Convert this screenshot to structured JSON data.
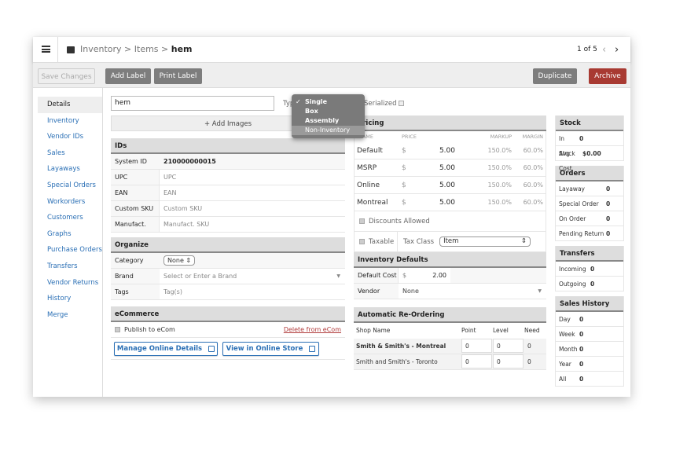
{
  "header": {
    "breadcrumb": [
      "Inventory",
      "Items",
      "hem"
    ],
    "pager": "1 of 5"
  },
  "toolbar": {
    "save": "Save Changes",
    "add_label": "Add Label",
    "print_label": "Print Label",
    "duplicate": "Duplicate",
    "archive": "Archive"
  },
  "colors": {
    "archive": "#a83a32",
    "link": "#2a6fb5",
    "delete_link": "#b03a3a"
  },
  "sidebar": [
    "Details",
    "Inventory",
    "Vendor IDs",
    "Sales",
    "Layaways",
    "Special Orders",
    "Workorders",
    "Customers",
    "Graphs",
    "Purchase Orders",
    "Transfers",
    "Vendor Returns",
    "History",
    "Merge"
  ],
  "item": {
    "name": "hem",
    "add_images": "+ Add Images",
    "type_label": "Type",
    "serialized": "Serialized"
  },
  "type_dropdown": {
    "options": [
      "Single",
      "Box",
      "Assembly",
      "Non-Inventory"
    ],
    "selected": "Single",
    "highlighted": "Non-Inventory"
  },
  "ids": {
    "title": "IDs",
    "system_id_label": "System ID",
    "system_id": "210000000015",
    "rows": [
      {
        "label": "UPC",
        "placeholder": "UPC"
      },
      {
        "label": "EAN",
        "placeholder": "EAN"
      },
      {
        "label": "Custom SKU",
        "placeholder": "Custom SKU"
      },
      {
        "label": "Manufact. SKU",
        "placeholder": "Manufact. SKU"
      }
    ]
  },
  "organize": {
    "title": "Organize",
    "category_label": "Category",
    "category": "None",
    "brand_label": "Brand",
    "brand_placeholder": "Select or Enter a Brand",
    "tags_label": "Tags",
    "tags_placeholder": "Tag(s)"
  },
  "ecommerce": {
    "title": "eCommerce",
    "publish": "Publish to eCom",
    "delete": "Delete from eCom",
    "manage": "Manage Online Details",
    "view": "View in Online Store"
  },
  "pricing": {
    "title": "Pricing",
    "cols": [
      "NAME",
      "PRICE",
      "MARKUP",
      "MARGIN"
    ],
    "rows": [
      {
        "name": "Default",
        "cur": "$",
        "price": "5.00",
        "markup": "150.0%",
        "margin": "60.0%"
      },
      {
        "name": "MSRP",
        "cur": "$",
        "price": "5.00",
        "markup": "150.0%",
        "margin": "60.0%"
      },
      {
        "name": "Online",
        "cur": "$",
        "price": "5.00",
        "markup": "150.0%",
        "margin": "60.0%"
      },
      {
        "name": "Montreal",
        "cur": "$",
        "price": "5.00",
        "markup": "150.0%",
        "margin": "60.0%"
      }
    ],
    "discounts": "Discounts Allowed",
    "taxable": "Taxable",
    "tax_class_label": "Tax Class",
    "tax_class": "Item"
  },
  "inv_defaults": {
    "title": "Inventory Defaults",
    "cost_label": "Default Cost",
    "cur": "$",
    "cost": "2.00",
    "vendor_label": "Vendor",
    "vendor": "None"
  },
  "reorder": {
    "title": "Automatic Re-Ordering",
    "cols": [
      "Shop Name",
      "Point",
      "Level",
      "Need"
    ],
    "rows": [
      {
        "shop": "Smith & Smith's - Montreal",
        "point": "0",
        "level": "0",
        "need": "0"
      },
      {
        "shop": "Smith and Smith's - Toronto",
        "point": "0",
        "level": "0",
        "need": "0"
      }
    ]
  },
  "stock": {
    "title": "Stock",
    "rows": [
      {
        "k": "In Stock",
        "v": "0"
      },
      {
        "k": "Avg. Cost",
        "v": "$0.00"
      }
    ]
  },
  "orders": {
    "title": "Orders",
    "rows": [
      {
        "k": "Layaway",
        "v": "0"
      },
      {
        "k": "Special Order",
        "v": "0"
      },
      {
        "k": "On Order",
        "v": "0"
      },
      {
        "k": "Pending Return",
        "v": "0"
      }
    ]
  },
  "transfers": {
    "title": "Transfers",
    "rows": [
      {
        "k": "Incoming",
        "v": "0"
      },
      {
        "k": "Outgoing",
        "v": "0"
      }
    ]
  },
  "sales_history": {
    "title": "Sales History",
    "rows": [
      {
        "k": "Day",
        "v": "0"
      },
      {
        "k": "Week",
        "v": "0"
      },
      {
        "k": "Month",
        "v": "0"
      },
      {
        "k": "Year",
        "v": "0"
      },
      {
        "k": "All",
        "v": "0"
      }
    ]
  }
}
